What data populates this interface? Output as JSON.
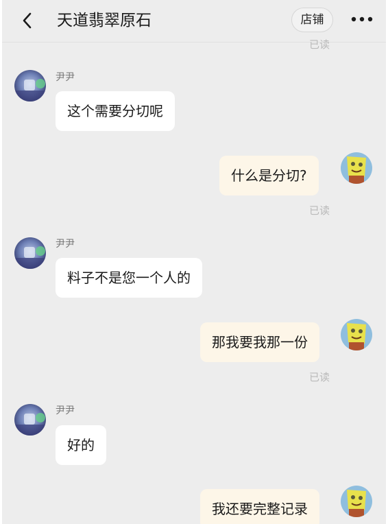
{
  "header": {
    "title": "天道翡翠原石",
    "store_label": "店铺",
    "icons": [
      "back-icon",
      "more-icon"
    ]
  },
  "cut_off_read_label": "已读",
  "messages": [
    {
      "direction": "incoming",
      "sender": "尹尹",
      "text": "这个需要分切呢"
    },
    {
      "direction": "outgoing",
      "text": "什么是分切?",
      "status": "已读"
    },
    {
      "direction": "incoming",
      "sender": "尹尹",
      "text": "料子不是您一个人的"
    },
    {
      "direction": "outgoing",
      "text": "那我要我那一份",
      "status": "已读"
    },
    {
      "direction": "incoming",
      "sender": "尹尹",
      "text": "好的"
    },
    {
      "direction": "outgoing",
      "text": "我还要完整记录"
    }
  ],
  "colors": {
    "background": "#ededed",
    "incoming_bubble": "#ffffff",
    "outgoing_bubble": "#fdf6e8",
    "read_text": "#b9b9b9"
  }
}
